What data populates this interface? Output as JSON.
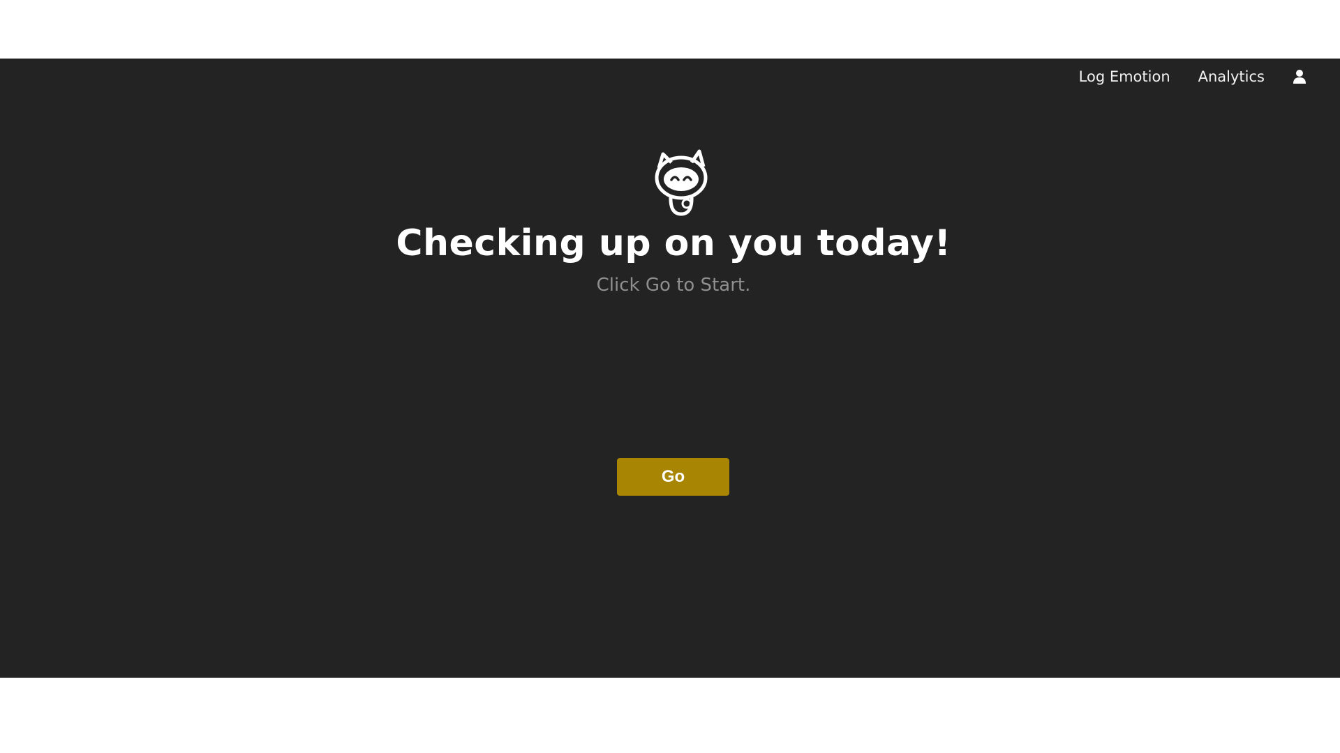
{
  "nav": {
    "links": [
      {
        "label": "Log Emotion"
      },
      {
        "label": "Analytics"
      }
    ],
    "user_icon": "user-icon"
  },
  "hero": {
    "mascot_icon": "cat-mascot-icon",
    "title": "Checking up on you today!",
    "subtitle": "Click Go to Start."
  },
  "actions": {
    "go_label": "Go"
  },
  "colors": {
    "background": "#232323",
    "accent": "#a88603",
    "text": "#ffffff",
    "muted_text": "#8f8f8f"
  }
}
